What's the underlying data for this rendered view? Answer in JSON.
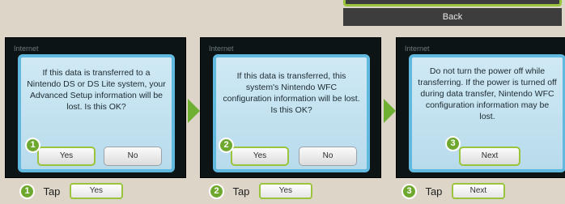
{
  "top_menu": {
    "back_label": "Back"
  },
  "panels": [
    {
      "title": "Internet",
      "message": "If this data is transferred to a Nintendo DS or DS Lite system, your Advanced Setup information will be lost. Is this OK?",
      "buttons": [
        "Yes",
        "No"
      ],
      "step": "1"
    },
    {
      "title": "Internet",
      "message": "If this data is transferred, this system's Nintendo WFC configuration information will be lost. Is this OK?",
      "buttons": [
        "Yes",
        "No"
      ],
      "step": "2"
    },
    {
      "title": "Internet",
      "message": "Do not turn the power off while transferring. If the power is turned off during data transfer, Nintendo WFC configuration information may be lost.",
      "buttons": [
        "Next"
      ],
      "step": "3"
    }
  ],
  "instructions": [
    {
      "step": "1",
      "tap": "Tap",
      "button": "Yes"
    },
    {
      "step": "2",
      "tap": "Tap",
      "button": "Yes"
    },
    {
      "step": "3",
      "tap": "Tap",
      "button": "Next"
    }
  ],
  "colors": {
    "background": "#ddd6c8",
    "accent_green": "#6fa82e",
    "highlight_green": "#9ac43c",
    "dialog_border": "#61b9df"
  }
}
